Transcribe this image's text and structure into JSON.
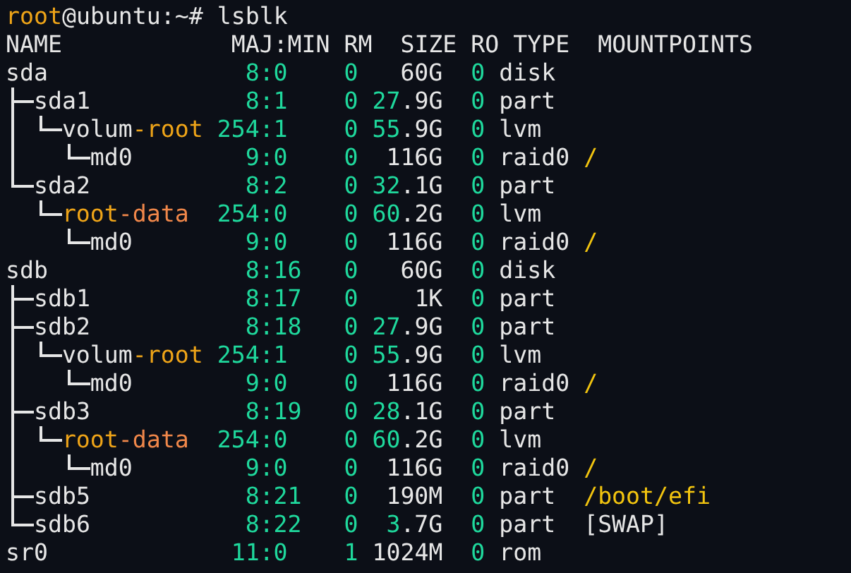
{
  "prompt": {
    "user": "root",
    "location": "@ubuntu:~#",
    "command": "lsblk"
  },
  "columns": [
    "NAME",
    "MAJ:MIN",
    "RM",
    "SIZE",
    "RO",
    "TYPE",
    "MOUNTPOINTS"
  ],
  "devices": [
    {
      "name": [
        {
          "text": "sda",
          "color": "#e6e6e6"
        }
      ],
      "majmin": "8:0",
      "rm": "0",
      "size": [
        {
          "text": "60G",
          "color": "#e6e6e6"
        }
      ],
      "ro": "0",
      "type": "disk",
      "children": [
        {
          "name": [
            {
              "text": "sda1",
              "color": "#e6e6e6"
            }
          ],
          "majmin": "8:1",
          "rm": "0",
          "size": [
            {
              "text": "27",
              "color": "#1fd89c"
            },
            {
              "text": ".9G",
              "color": "#e6e6e6"
            }
          ],
          "ro": "0",
          "type": "part",
          "children": [
            {
              "name": [
                {
                  "text": "volum",
                  "color": "#e6e6e6"
                },
                {
                  "text": "-root",
                  "color": "#eea418"
                }
              ],
              "majmin": "254:1",
              "rm": "0",
              "size": [
                {
                  "text": "55",
                  "color": "#1fd89c"
                },
                {
                  "text": ".9G",
                  "color": "#e6e6e6"
                }
              ],
              "ro": "0",
              "type": "lvm",
              "children": [
                {
                  "name": [
                    {
                      "text": "md0",
                      "color": "#e6e6e6"
                    }
                  ],
                  "majmin": "9:0",
                  "rm": "0",
                  "size": [
                    {
                      "text": "116G",
                      "color": "#e6e6e6"
                    }
                  ],
                  "ro": "0",
                  "type": "raid0",
                  "mount": {
                    "text": "/",
                    "color": "#f2c40f"
                  }
                }
              ]
            }
          ]
        },
        {
          "name": [
            {
              "text": "sda2",
              "color": "#e6e6e6"
            }
          ],
          "majmin": "8:2",
          "rm": "0",
          "size": [
            {
              "text": "32",
              "color": "#1fd89c"
            },
            {
              "text": ".1G",
              "color": "#e6e6e6"
            }
          ],
          "ro": "0",
          "type": "part",
          "children": [
            {
              "name": [
                {
                  "text": "root",
                  "color": "#eea418"
                },
                {
                  "text": "-data",
                  "color": "#f0874a"
                }
              ],
              "majmin": "254:0",
              "rm": "0",
              "size": [
                {
                  "text": "60",
                  "color": "#1fd89c"
                },
                {
                  "text": ".2G",
                  "color": "#e6e6e6"
                }
              ],
              "ro": "0",
              "type": "lvm",
              "children": [
                {
                  "name": [
                    {
                      "text": "md0",
                      "color": "#e6e6e6"
                    }
                  ],
                  "majmin": "9:0",
                  "rm": "0",
                  "size": [
                    {
                      "text": "116G",
                      "color": "#e6e6e6"
                    }
                  ],
                  "ro": "0",
                  "type": "raid0",
                  "mount": {
                    "text": "/",
                    "color": "#f2c40f"
                  }
                }
              ]
            }
          ]
        }
      ]
    },
    {
      "name": [
        {
          "text": "sdb",
          "color": "#e6e6e6"
        }
      ],
      "majmin": "8:16",
      "rm": "0",
      "size": [
        {
          "text": "60G",
          "color": "#e6e6e6"
        }
      ],
      "ro": "0",
      "type": "disk",
      "children": [
        {
          "name": [
            {
              "text": "sdb1",
              "color": "#e6e6e6"
            }
          ],
          "majmin": "8:17",
          "rm": "0",
          "size": [
            {
              "text": "1K",
              "color": "#e6e6e6"
            }
          ],
          "ro": "0",
          "type": "part"
        },
        {
          "name": [
            {
              "text": "sdb2",
              "color": "#e6e6e6"
            }
          ],
          "majmin": "8:18",
          "rm": "0",
          "size": [
            {
              "text": "27",
              "color": "#1fd89c"
            },
            {
              "text": ".9G",
              "color": "#e6e6e6"
            }
          ],
          "ro": "0",
          "type": "part",
          "children": [
            {
              "name": [
                {
                  "text": "volum",
                  "color": "#e6e6e6"
                },
                {
                  "text": "-root",
                  "color": "#eea418"
                }
              ],
              "majmin": "254:1",
              "rm": "0",
              "size": [
                {
                  "text": "55",
                  "color": "#1fd89c"
                },
                {
                  "text": ".9G",
                  "color": "#e6e6e6"
                }
              ],
              "ro": "0",
              "type": "lvm",
              "children": [
                {
                  "name": [
                    {
                      "text": "md0",
                      "color": "#e6e6e6"
                    }
                  ],
                  "majmin": "9:0",
                  "rm": "0",
                  "size": [
                    {
                      "text": "116G",
                      "color": "#e6e6e6"
                    }
                  ],
                  "ro": "0",
                  "type": "raid0",
                  "mount": {
                    "text": "/",
                    "color": "#f2c40f"
                  }
                }
              ]
            }
          ]
        },
        {
          "name": [
            {
              "text": "sdb3",
              "color": "#e6e6e6"
            }
          ],
          "majmin": "8:19",
          "rm": "0",
          "size": [
            {
              "text": "28",
              "color": "#1fd89c"
            },
            {
              "text": ".1G",
              "color": "#e6e6e6"
            }
          ],
          "ro": "0",
          "type": "part",
          "children": [
            {
              "name": [
                {
                  "text": "root",
                  "color": "#eea418"
                },
                {
                  "text": "-data",
                  "color": "#f0874a"
                }
              ],
              "majmin": "254:0",
              "rm": "0",
              "size": [
                {
                  "text": "60",
                  "color": "#1fd89c"
                },
                {
                  "text": ".2G",
                  "color": "#e6e6e6"
                }
              ],
              "ro": "0",
              "type": "lvm",
              "children": [
                {
                  "name": [
                    {
                      "text": "md0",
                      "color": "#e6e6e6"
                    }
                  ],
                  "majmin": "9:0",
                  "rm": "0",
                  "size": [
                    {
                      "text": "116G",
                      "color": "#e6e6e6"
                    }
                  ],
                  "ro": "0",
                  "type": "raid0",
                  "mount": {
                    "text": "/",
                    "color": "#f2c40f"
                  }
                }
              ]
            }
          ]
        },
        {
          "name": [
            {
              "text": "sdb5",
              "color": "#e6e6e6"
            }
          ],
          "majmin": "8:21",
          "rm": "0",
          "size": [
            {
              "text": "190M",
              "color": "#e6e6e6"
            }
          ],
          "ro": "0",
          "type": "part",
          "mount": {
            "text": "/boot/efi",
            "color": "#f2c40f"
          }
        },
        {
          "name": [
            {
              "text": "sdb6",
              "color": "#e6e6e6"
            }
          ],
          "majmin": "8:22",
          "rm": "0",
          "size": [
            {
              "text": "3",
              "color": "#1fd89c"
            },
            {
              "text": ".7G",
              "color": "#e6e6e6"
            }
          ],
          "ro": "0",
          "type": "part",
          "mount": {
            "text": "[SWAP]",
            "color": "#e6e6e6"
          }
        }
      ]
    },
    {
      "name": [
        {
          "text": "sr0",
          "color": "#e6e6e6"
        }
      ],
      "majmin": "11:0",
      "rm": "1",
      "size": [
        {
          "text": "1024M",
          "color": "#e6e6e6"
        }
      ],
      "ro": "0",
      "type": "rom"
    }
  ]
}
